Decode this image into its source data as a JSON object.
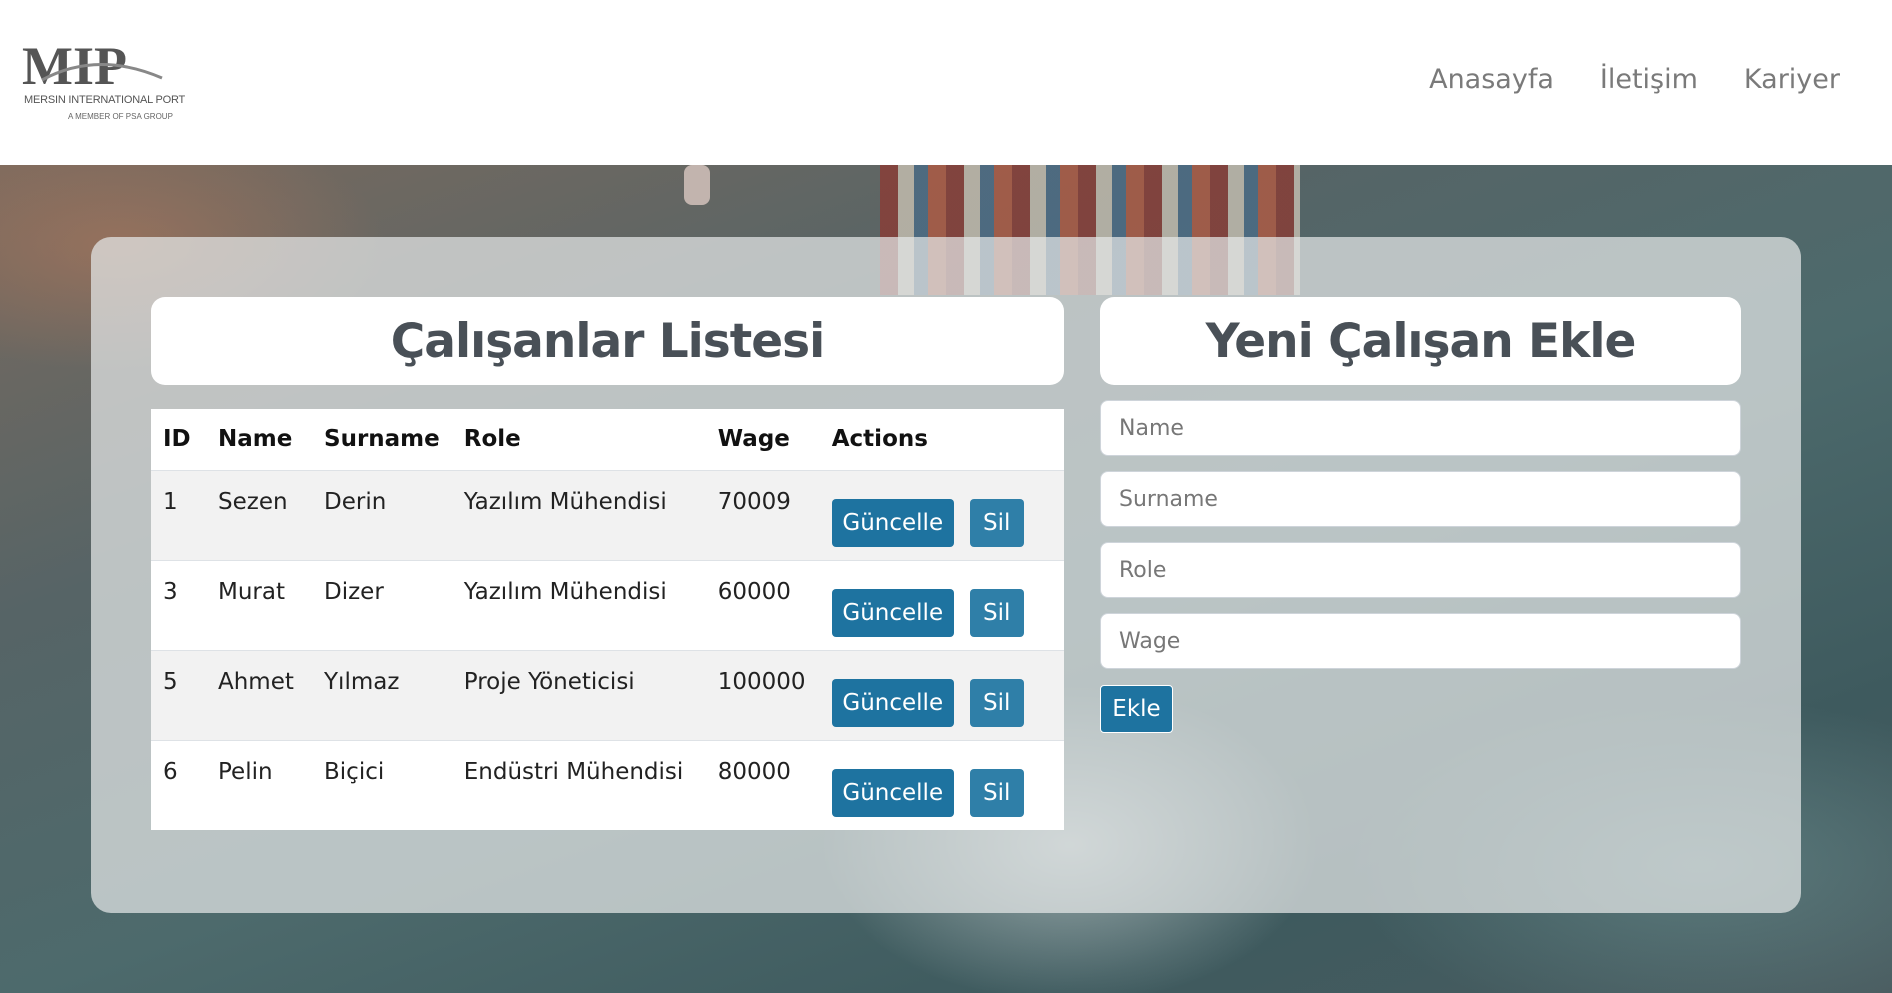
{
  "header": {
    "logo": {
      "mark_text": "MIP",
      "line1": "MERSIN INTERNATIONAL PORT",
      "line2": "A MEMBER OF PSA GROUP"
    },
    "nav": [
      "Anasayfa",
      "İletişim",
      "Kariyer"
    ]
  },
  "list_card": {
    "title": "Çalışanlar Listesi",
    "columns": [
      "ID",
      "Name",
      "Surname",
      "Role",
      "Wage",
      "Actions"
    ],
    "rows": [
      {
        "id": "1",
        "name": "Sezen",
        "surname": "Derin",
        "role": "Yazılım Mühendisi",
        "wage": "70009"
      },
      {
        "id": "3",
        "name": "Murat",
        "surname": "Dizer",
        "role": "Yazılım Mühendisi",
        "wage": "60000"
      },
      {
        "id": "5",
        "name": "Ahmet",
        "surname": "Yılmaz",
        "role": "Proje Yöneticisi",
        "wage": "100000"
      },
      {
        "id": "6",
        "name": "Pelin",
        "surname": "Biçici",
        "role": "Endüstri Mühendisi",
        "wage": "80000"
      }
    ],
    "update_label": "Güncelle",
    "delete_label": "Sil"
  },
  "form_card": {
    "title": "Yeni Çalışan Ekle",
    "placeholders": {
      "name": "Name",
      "surname": "Surname",
      "role": "Role",
      "wage": "Wage"
    },
    "values": {
      "name": "",
      "surname": "",
      "role": "",
      "wage": ""
    },
    "submit_label": "Ekle"
  },
  "colors": {
    "primary_button": "#1e73a0",
    "title_text": "#495057"
  }
}
